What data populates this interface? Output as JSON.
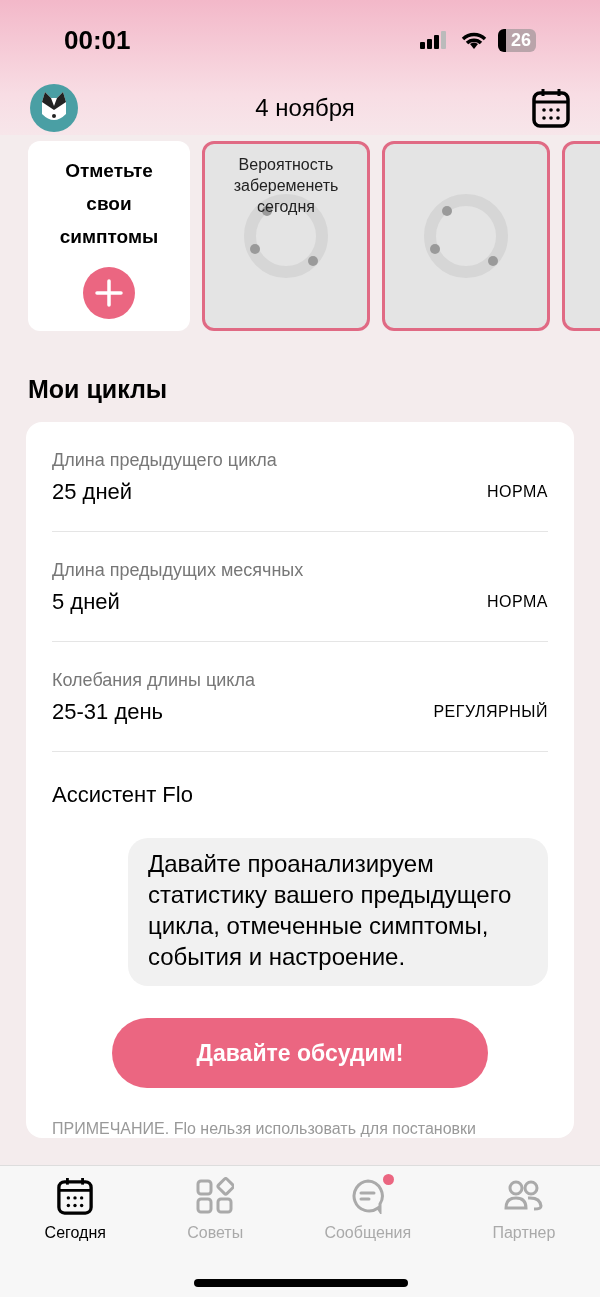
{
  "status_bar": {
    "time": "00:01",
    "battery": "26"
  },
  "header": {
    "date": "4 ноября"
  },
  "tiles": [
    {
      "kind": "symptoms",
      "title": "Отметьте свои симптомы"
    },
    {
      "kind": "loading",
      "title": "Вероятность забеременеть сегодня"
    },
    {
      "kind": "loading"
    },
    {
      "kind": "edge"
    }
  ],
  "cycles": {
    "title": "Мои циклы",
    "stats": [
      {
        "label": "Длина предыдущего цикла",
        "value": "25 дней",
        "status": "НОРМА"
      },
      {
        "label": "Длина предыдущих месячных",
        "value": "5 дней",
        "status": "НОРМА"
      },
      {
        "label": "Колебания длины цикла",
        "value": "25-31 день",
        "status": "РЕГУЛЯРНЫЙ"
      }
    ],
    "assistant": {
      "title": "Ассистент Flo",
      "message": "Давайте проанализируем статистику вашего предыдущего цикла, отмеченные симптомы, события и настроение.",
      "button": "Давайте обсудим!"
    },
    "note": "ПРИМЕЧАНИЕ. Flo нельзя использовать для постановки"
  },
  "tab_bar": [
    {
      "label": "Сегодня",
      "kind": "calendar",
      "selected": true,
      "badge": false
    },
    {
      "label": "Советы",
      "kind": "grid",
      "selected": false,
      "badge": false
    },
    {
      "label": "Сообщения",
      "kind": "chat",
      "selected": false,
      "badge": true
    },
    {
      "label": "Партнер",
      "kind": "people",
      "selected": false,
      "badge": false
    }
  ]
}
